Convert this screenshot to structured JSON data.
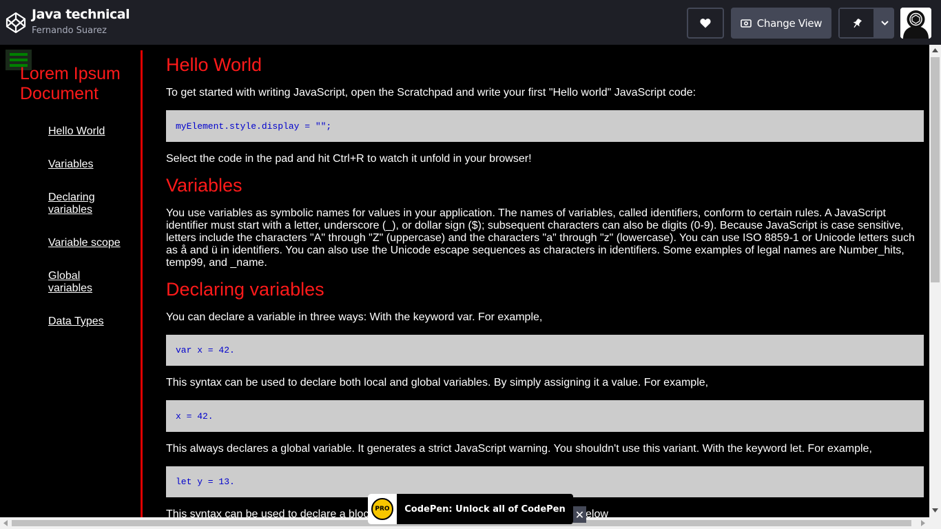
{
  "header": {
    "pen_title": "Java technical",
    "author": "Fernando Suarez",
    "change_view_label": "Change View"
  },
  "sidebar": {
    "title": "Lorem Ipsum Document",
    "links": [
      "Hello World",
      "Variables",
      "Declaring variables",
      "Variable scope",
      "Global variables",
      "Data Types"
    ]
  },
  "content": {
    "hello_world": {
      "heading": "Hello World",
      "intro": "To get started with writing JavaScript, open the Scratchpad and write your first \"Hello world\" JavaScript code:",
      "code": "myElement.style.display = \"\";",
      "after": "Select the code in the pad and hit Ctrl+R to watch it unfold in your browser!"
    },
    "variables": {
      "heading": "Variables",
      "body": "You use variables as symbolic names for values in your application. The names of variables, called identifiers, conform to certain rules. A JavaScript identifier must start with a letter, underscore (_), or dollar sign ($); subsequent characters can also be digits (0-9). Because JavaScript is case sensitive, letters include the characters \"A\" through \"Z\" (uppercase) and the characters \"a\" through \"z\" (lowercase). You can use ISO 8859-1 or Unicode letters such as å and ü in identifiers. You can also use the Unicode escape sequences as characters in identifiers. Some examples of legal names are Number_hits, temp99, and _name."
    },
    "declaring": {
      "heading": "Declaring variables",
      "intro": "You can declare a variable in three ways: With the keyword var. For example,",
      "code1": "var x = 42.",
      "p2": "This syntax can be used to declare both local and global variables. By simply assigning it a value. For example,",
      "code2": "x = 42.",
      "p3": "This always declares a global variable. It generates a strict JavaScript warning. You shouldn't use this variant. With the keyword let. For example,",
      "code3": "let y = 13.",
      "p4_start": "This syntax can be used to declare a bloc",
      "p4_end": "elow"
    }
  },
  "promo": {
    "badge": "PRO",
    "text": "CodePen: Unlock all of CodePen",
    "close": "✕"
  },
  "icons": {
    "logo": "codepen-logo-icon",
    "love": "heart-icon",
    "change_view": "eye-icon",
    "pin": "pin-icon",
    "caret": "chevron-down-icon",
    "menu": "hamburger-menu-icon"
  },
  "colors": {
    "topbar_bg": "#1e1f26",
    "button_bg": "#444857",
    "heading_red": "#ff1a1a",
    "divider_red": "#e00000",
    "code_bg": "#cccccc",
    "code_text": "#0000cc",
    "menu_green": "#008000"
  }
}
